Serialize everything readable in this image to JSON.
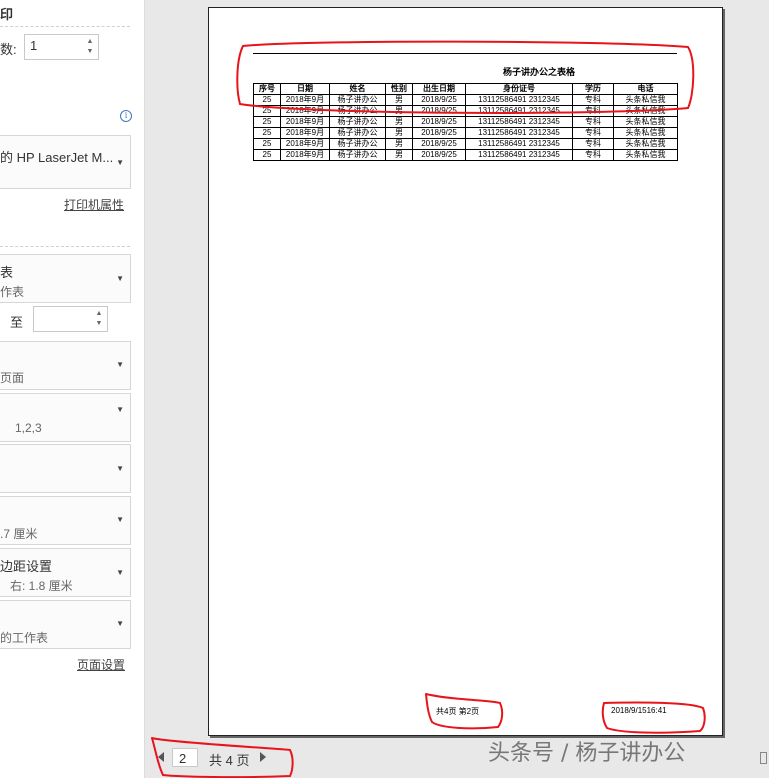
{
  "panel": {
    "section_title": "印",
    "copies_label": "数:",
    "copies_value": "1",
    "printer_name": "的 HP LaserJet M...",
    "printer_props_link": "打印机属性",
    "settings": [
      {
        "line1": "表",
        "line2": "作表"
      },
      {
        "range_to": "至"
      },
      {
        "line1": "",
        "line2": "页面"
      },
      {
        "line1": "",
        "line2": "1,2,3"
      },
      {
        "line1": "",
        "line2": ""
      },
      {
        "line1": "",
        "line2": ".7 厘米"
      },
      {
        "line1": "边距设置",
        "line2": "右:  1.8 厘米"
      },
      {
        "line1": "",
        "line2": "的工作表"
      }
    ],
    "page_setup_link": "页面设置"
  },
  "sheet": {
    "title": "杨子讲办公之表格",
    "headers": [
      "序号",
      "日期",
      "姓名",
      "性别",
      "出生日期",
      "身份证号",
      "学历",
      "电话"
    ],
    "rows": [
      [
        "25",
        "2018年9月",
        "杨子讲办公",
        "男",
        "2018/9/25",
        "13112586491 2312345",
        "专科",
        "头条私信我"
      ],
      [
        "25",
        "2018年9月",
        "杨子讲办公",
        "男",
        "2018/9/25",
        "13112586491 2312345",
        "专科",
        "头条私信我"
      ],
      [
        "25",
        "2018年9月",
        "杨子讲办公",
        "男",
        "2018/9/25",
        "13112586491 2312345",
        "专科",
        "头条私信我"
      ],
      [
        "25",
        "2018年9月",
        "杨子讲办公",
        "男",
        "2018/9/25",
        "13112586491 2312345",
        "专科",
        "头条私信我"
      ],
      [
        "25",
        "2018年9月",
        "杨子讲办公",
        "男",
        "2018/9/25",
        "13112586491 2312345",
        "专科",
        "头条私信我"
      ],
      [
        "25",
        "2018年9月",
        "杨子讲办公",
        "男",
        "2018/9/25",
        "13112586491 2312345",
        "专科",
        "头条私信我"
      ]
    ],
    "footer_pages": "共4页  第2页",
    "footer_datetime": "2018/9/1516:41"
  },
  "nav": {
    "current_page": "2",
    "total_label": "共 4 页"
  },
  "watermark": "头条号 / 杨子讲办公",
  "colors": {
    "annotation": "#e8141b"
  }
}
